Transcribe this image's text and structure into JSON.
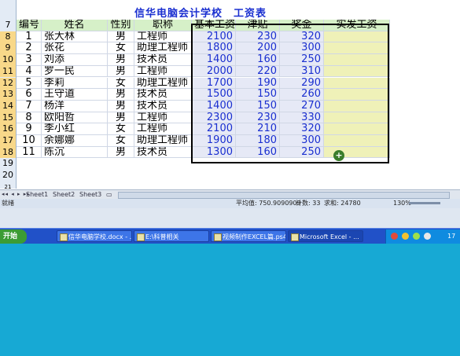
{
  "title": "信华电脑会计学校　工资表",
  "headers": [
    "编号",
    "姓名",
    "性别",
    "职称",
    "基本工资",
    "津贴",
    "奖金",
    "实发工资"
  ],
  "header_row_number": "7",
  "rows": [
    {
      "rn": "8",
      "id": "1",
      "name": "张大林",
      "gender": "男",
      "title": "工程师",
      "base": "2100",
      "allow": "230",
      "bonus": "320"
    },
    {
      "rn": "9",
      "id": "2",
      "name": "张花",
      "gender": "女",
      "title": "助理工程师",
      "base": "1800",
      "allow": "200",
      "bonus": "300"
    },
    {
      "rn": "10",
      "id": "3",
      "name": "刘添",
      "gender": "男",
      "title": "技术员",
      "base": "1400",
      "allow": "160",
      "bonus": "250"
    },
    {
      "rn": "11",
      "id": "4",
      "name": "罗一民",
      "gender": "男",
      "title": "工程师",
      "base": "2000",
      "allow": "220",
      "bonus": "310"
    },
    {
      "rn": "12",
      "id": "5",
      "name": "李莉",
      "gender": "女",
      "title": "助理工程师",
      "base": "1700",
      "allow": "190",
      "bonus": "290"
    },
    {
      "rn": "13",
      "id": "6",
      "name": "王守道",
      "gender": "男",
      "title": "技术员",
      "base": "1500",
      "allow": "150",
      "bonus": "260"
    },
    {
      "rn": "14",
      "id": "7",
      "name": "杨洋",
      "gender": "男",
      "title": "技术员",
      "base": "1400",
      "allow": "150",
      "bonus": "270"
    },
    {
      "rn": "15",
      "id": "8",
      "name": "欧阳哲",
      "gender": "男",
      "title": "工程师",
      "base": "2300",
      "allow": "230",
      "bonus": "330"
    },
    {
      "rn": "16",
      "id": "9",
      "name": "李小红",
      "gender": "女",
      "title": "工程师",
      "base": "2100",
      "allow": "210",
      "bonus": "320"
    },
    {
      "rn": "17",
      "id": "10",
      "name": "余娜娜",
      "gender": "女",
      "title": "助理工程师",
      "base": "1900",
      "allow": "180",
      "bonus": "300"
    },
    {
      "rn": "18",
      "id": "11",
      "name": "陈沉",
      "gender": "男",
      "title": "技术员",
      "base": "1300",
      "allow": "160",
      "bonus": "250"
    }
  ],
  "extra_row_numbers": [
    "19",
    "20",
    "21"
  ],
  "sheet_tabs": [
    "Sheet1",
    "Sheet2",
    "Sheet3"
  ],
  "tab_nav": "◂◂ ◂ ▸ ▸▸",
  "status": {
    "ready": "就绪",
    "average": "平均值: 750.9090909",
    "count": "计数: 33",
    "sum": "求和: 24780",
    "zoom": "130%"
  },
  "taskbar": {
    "start": "开始",
    "items": [
      "信华电脑学校.docx - ...",
      "E:\\科普相关",
      "视频制作EXCEL篇.ps4...",
      "Microsoft Excel - ..."
    ],
    "clock": "17"
  },
  "colors": {
    "header_bg": "#d6f0c8",
    "title_blue": "#1a2fd0",
    "selection_fill": "#e6e9f6",
    "yellow_fill": "#eff1b8",
    "taskbar": "#2151c8",
    "desktop": "#17a9d4"
  }
}
